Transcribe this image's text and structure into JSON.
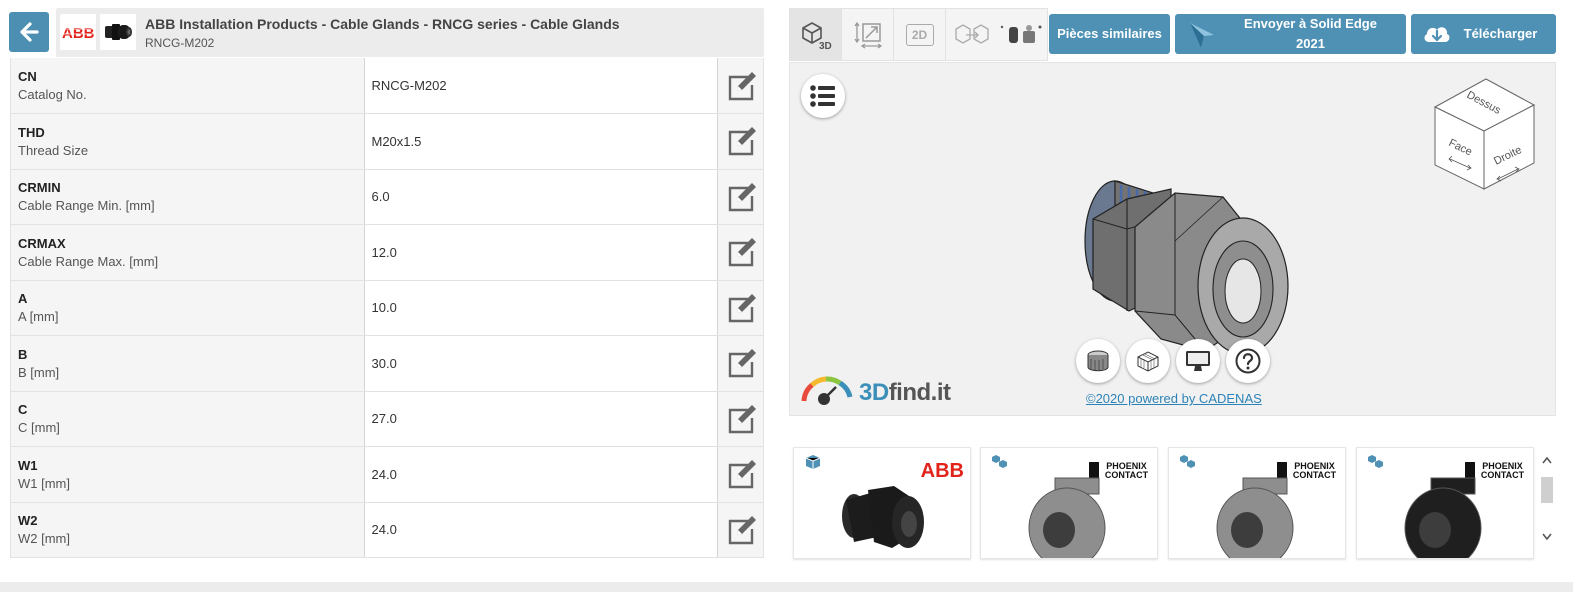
{
  "header": {
    "title": "ABB Installation Products - Cable Glands - RNCG series - Cable Glands",
    "subtitle": "RNCG-M202",
    "brand_logo": "ABB"
  },
  "properties": [
    {
      "code": "CN",
      "name": "Catalog No.",
      "value": "RNCG-M202"
    },
    {
      "code": "THD",
      "name": "Thread Size",
      "value": "M20x1.5"
    },
    {
      "code": "CRMIN",
      "name": "Cable Range Min. [mm]",
      "value": "6.0"
    },
    {
      "code": "CRMAX",
      "name": "Cable Range Max. [mm]",
      "value": "12.0"
    },
    {
      "code": "A",
      "name": "A [mm]",
      "value": "10.0"
    },
    {
      "code": "B",
      "name": "B [mm]",
      "value": "30.0"
    },
    {
      "code": "C",
      "name": "C [mm]",
      "value": "27.0"
    },
    {
      "code": "W1",
      "name": "W1 [mm]",
      "value": "24.0"
    },
    {
      "code": "W2",
      "name": "W2 [mm]",
      "value": "24.0"
    }
  ],
  "toolbar": {
    "tab_3d": "3D",
    "tab_2d": "2D",
    "similar_label": "Pièces similaires",
    "send_label_1": "Envoyer à Solid Edge",
    "send_label_2": "2021",
    "download_label": "Télécharger"
  },
  "viewer": {
    "cube_top": "Dessus",
    "cube_front": "Face",
    "cube_right": "Droite",
    "brand_a": "3D",
    "brand_b": "find.it",
    "copyright": "©2020 powered by CADENAS"
  },
  "similar_parts": [
    {
      "brand": "ABB",
      "color": "#1a1a1a"
    },
    {
      "brand": "PHOENIX CONTACT",
      "color": "#8e8e8e"
    },
    {
      "brand": "PHOENIX CONTACT",
      "color": "#8e8e8e"
    },
    {
      "brand": "PHOENIX CONTACT",
      "color": "#1f1f1f"
    }
  ],
  "colors": {
    "accent": "#4e91b5",
    "abb_red": "#e2231a",
    "link": "#2c83b7"
  }
}
